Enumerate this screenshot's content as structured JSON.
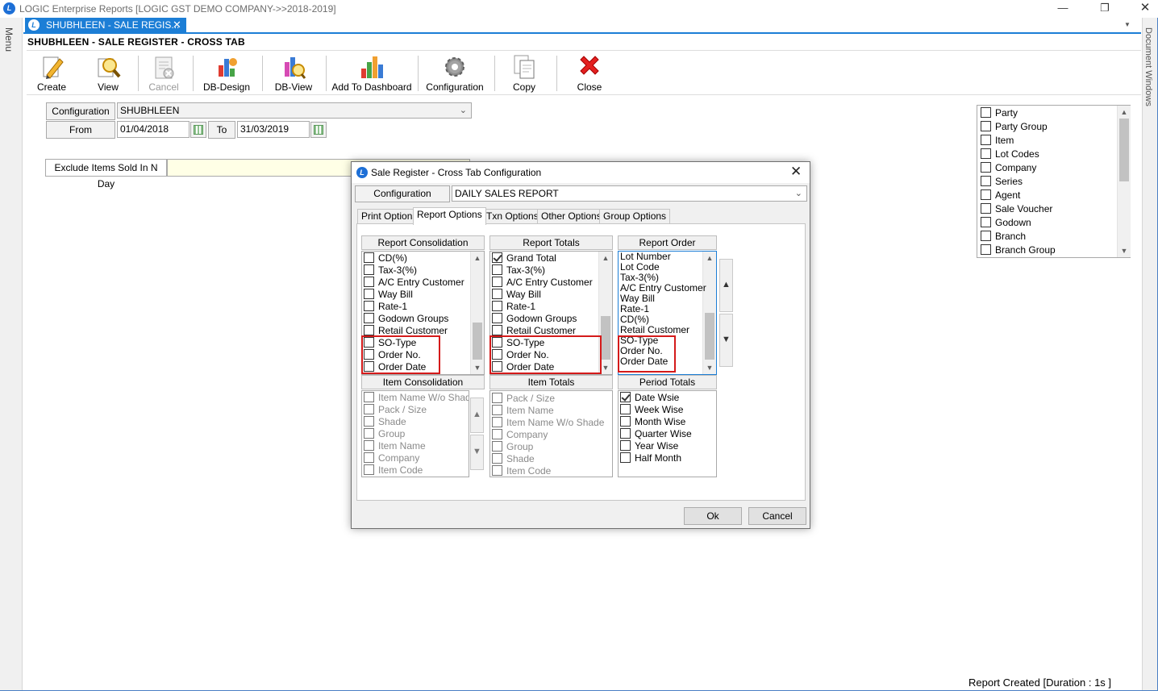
{
  "window": {
    "title": "LOGIC Enterprise Reports  [LOGIC GST DEMO COMPANY->>2018-2019]",
    "menu_label": "Menu",
    "doc_windows_label": "Document Windows"
  },
  "tab": {
    "label": "SHUBHLEEN - SALE REGIS..."
  },
  "report_header": "SHUBHLEEN - SALE REGISTER - CROSS TAB",
  "toolbar": {
    "create": "Create",
    "view": "View",
    "cancel": "Cancel",
    "db_design": "DB-Design",
    "db_view": "DB-View",
    "add_dashboard": "Add To Dashboard",
    "configuration": "Configuration",
    "copy": "Copy",
    "close": "Close"
  },
  "filters": {
    "config_label": "Configuration",
    "config_value": "SHUBHLEEN",
    "from_label": "From",
    "from_value": "01/04/2018",
    "to_label": "To",
    "to_value": "31/03/2019",
    "exclude_label": "Exclude Items Sold In N Day"
  },
  "entity_list": [
    {
      "label": "Party",
      "checked": false
    },
    {
      "label": "Party Group",
      "checked": false
    },
    {
      "label": "Item",
      "checked": false
    },
    {
      "label": "Lot Codes",
      "checked": false
    },
    {
      "label": "Company",
      "checked": false
    },
    {
      "label": "Series",
      "checked": false
    },
    {
      "label": "Agent",
      "checked": false
    },
    {
      "label": "Sale Voucher",
      "checked": false
    },
    {
      "label": "Godown",
      "checked": false
    },
    {
      "label": "Branch",
      "checked": false
    },
    {
      "label": "Branch Group",
      "checked": false
    }
  ],
  "status": "Report Created [Duration : 1s ]",
  "dialog": {
    "title": "Sale Register - Cross Tab Configuration",
    "config_label": "Configuration",
    "config_value": "DAILY SALES REPORT",
    "tabs": [
      "Print Options",
      "Report Options",
      "Txn Options",
      "Other Options",
      "Group Options"
    ],
    "active_tab": "Report Options",
    "report_consolidation": {
      "title": "Report Consolidation",
      "items": [
        "CD(%)",
        "Tax-3(%)",
        "A/C Entry Customer",
        "Way Bill",
        "Rate-1",
        "Godown Groups",
        "Retail Customer",
        "SO-Type",
        "Order No.",
        "Order Date"
      ]
    },
    "report_totals": {
      "title": "Report Totals",
      "items": [
        "Grand Total",
        "Tax-3(%)",
        "A/C Entry Customer",
        "Way Bill",
        "Rate-1",
        "Godown Groups",
        "Retail Customer",
        "SO-Type",
        "Order No.",
        "Order Date"
      ],
      "checked": [
        "Grand Total"
      ]
    },
    "report_order": {
      "title": "Report Order",
      "items": [
        "Lot Number",
        "Lot Code",
        "Tax-3(%)",
        "A/C Entry Customer",
        "Way Bill",
        "Rate-1",
        "CD(%)",
        "Retail Customer",
        "SO-Type",
        "Order No.",
        "Order Date"
      ]
    },
    "item_consolidation": {
      "title": "Item Consolidation",
      "items": [
        "Item Name W/o Shade",
        "Pack / Size",
        "Shade",
        "Group",
        "Item Name",
        "Company",
        "Item Code"
      ]
    },
    "item_totals": {
      "title": "Item Totals",
      "items": [
        "Pack / Size",
        "Item Name",
        "Item Name W/o Shade",
        "Company",
        "Group",
        "Shade",
        "Item Code"
      ]
    },
    "period_totals": {
      "title": "Period Totals",
      "items": [
        "Date Wsie",
        "Week Wise",
        "Month Wise",
        "Quarter Wise",
        "Year Wise",
        "Half Month"
      ],
      "checked": [
        "Date Wsie"
      ]
    },
    "ok": "Ok",
    "cancel": "Cancel"
  }
}
